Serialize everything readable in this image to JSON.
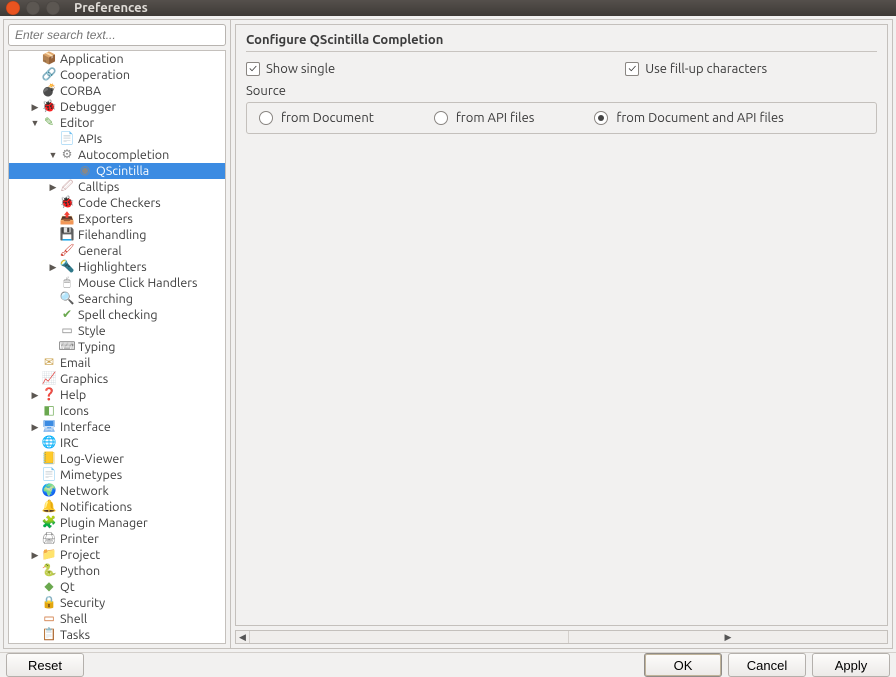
{
  "window": {
    "title": "Preferences"
  },
  "search": {
    "placeholder": "Enter search text..."
  },
  "tree": {
    "items": [
      {
        "depth": 1,
        "arrow": "",
        "icon": "📦",
        "icolor": "#6aa84f",
        "label": "Application"
      },
      {
        "depth": 1,
        "arrow": "",
        "icon": "🔗",
        "icolor": "#555",
        "label": "Cooperation"
      },
      {
        "depth": 1,
        "arrow": "",
        "icon": "💣",
        "icolor": "#cc3b2e",
        "label": "CORBA"
      },
      {
        "depth": 1,
        "arrow": "▶",
        "icon": "🐞",
        "icolor": "#cc3b2e",
        "label": "Debugger"
      },
      {
        "depth": 1,
        "arrow": "▼",
        "icon": "✎",
        "icolor": "#6aa84f",
        "label": "Editor"
      },
      {
        "depth": 2,
        "arrow": "",
        "icon": "📄",
        "icolor": "#7aa",
        "label": "APIs"
      },
      {
        "depth": 2,
        "arrow": "▼",
        "icon": "⚙",
        "icolor": "#888",
        "label": "Autocompletion"
      },
      {
        "depth": 3,
        "arrow": "",
        "icon": "◉",
        "icolor": "#888",
        "label": "QScintilla",
        "selected": true
      },
      {
        "depth": 2,
        "arrow": "▶",
        "icon": "🖉",
        "icolor": "#caa",
        "label": "Calltips"
      },
      {
        "depth": 2,
        "arrow": "",
        "icon": "🐞",
        "icolor": "#cc3b2e",
        "label": "Code Checkers"
      },
      {
        "depth": 2,
        "arrow": "",
        "icon": "📤",
        "icolor": "#7aa",
        "label": "Exporters"
      },
      {
        "depth": 2,
        "arrow": "",
        "icon": "💾",
        "icolor": "#555",
        "label": "Filehandling"
      },
      {
        "depth": 2,
        "arrow": "",
        "icon": "🖌",
        "icolor": "#cc3b2e",
        "label": "General"
      },
      {
        "depth": 2,
        "arrow": "▶",
        "icon": "🔦",
        "icolor": "#caa04a",
        "label": "Highlighters"
      },
      {
        "depth": 2,
        "arrow": "",
        "icon": "🖱",
        "icolor": "#888",
        "label": "Mouse Click Handlers"
      },
      {
        "depth": 2,
        "arrow": "",
        "icon": "🔍",
        "icolor": "#555",
        "label": "Searching"
      },
      {
        "depth": 2,
        "arrow": "",
        "icon": "✔",
        "icolor": "#6aa84f",
        "label": "Spell checking"
      },
      {
        "depth": 2,
        "arrow": "",
        "icon": "▭",
        "icolor": "#888",
        "label": "Style"
      },
      {
        "depth": 2,
        "arrow": "",
        "icon": "⌨",
        "icolor": "#888",
        "label": "Typing"
      },
      {
        "depth": 1,
        "arrow": "",
        "icon": "✉",
        "icolor": "#caa04a",
        "label": "Email"
      },
      {
        "depth": 1,
        "arrow": "",
        "icon": "📈",
        "icolor": "#cc3b2e",
        "label": "Graphics"
      },
      {
        "depth": 1,
        "arrow": "▶",
        "icon": "❓",
        "icolor": "#3b8be2",
        "label": "Help"
      },
      {
        "depth": 1,
        "arrow": "",
        "icon": "◧",
        "icolor": "#6aa84f",
        "label": "Icons"
      },
      {
        "depth": 1,
        "arrow": "▶",
        "icon": "🖥",
        "icolor": "#3b8be2",
        "label": "Interface"
      },
      {
        "depth": 1,
        "arrow": "",
        "icon": "🌐",
        "icolor": "#6aa84f",
        "label": "IRC"
      },
      {
        "depth": 1,
        "arrow": "",
        "icon": "📒",
        "icolor": "#caa04a",
        "label": "Log-Viewer"
      },
      {
        "depth": 1,
        "arrow": "",
        "icon": "📄",
        "icolor": "#888",
        "label": "Mimetypes"
      },
      {
        "depth": 1,
        "arrow": "",
        "icon": "🌍",
        "icolor": "#3b8be2",
        "label": "Network"
      },
      {
        "depth": 1,
        "arrow": "",
        "icon": "🔔",
        "icolor": "#555",
        "label": "Notifications"
      },
      {
        "depth": 1,
        "arrow": "",
        "icon": "🧩",
        "icolor": "#6aa84f",
        "label": "Plugin Manager"
      },
      {
        "depth": 1,
        "arrow": "",
        "icon": "🖨",
        "icolor": "#888",
        "label": "Printer"
      },
      {
        "depth": 1,
        "arrow": "▶",
        "icon": "📁",
        "icolor": "#3b8be2",
        "label": "Project"
      },
      {
        "depth": 1,
        "arrow": "",
        "icon": "🐍",
        "icolor": "#caa04a",
        "label": "Python"
      },
      {
        "depth": 1,
        "arrow": "",
        "icon": "◆",
        "icolor": "#6aa84f",
        "label": "Qt"
      },
      {
        "depth": 1,
        "arrow": "",
        "icon": "🔒",
        "icolor": "#caa04a",
        "label": "Security"
      },
      {
        "depth": 1,
        "arrow": "",
        "icon": "▭",
        "icolor": "#cc6b2e",
        "label": "Shell"
      },
      {
        "depth": 1,
        "arrow": "",
        "icon": "📋",
        "icolor": "#cc3b2e",
        "label": "Tasks"
      }
    ]
  },
  "config": {
    "title": "Configure QScintilla Completion",
    "checks": [
      {
        "label": "Show single",
        "checked": true
      },
      {
        "label": "Use fill-up characters",
        "checked": true
      }
    ],
    "source_label": "Source",
    "radios": [
      {
        "label": "from Document",
        "checked": false
      },
      {
        "label": "from API files",
        "checked": false
      },
      {
        "label": "from Document and API files",
        "checked": true
      }
    ]
  },
  "buttons": {
    "reset": "Reset",
    "ok": "OK",
    "cancel": "Cancel",
    "apply": "Apply"
  }
}
